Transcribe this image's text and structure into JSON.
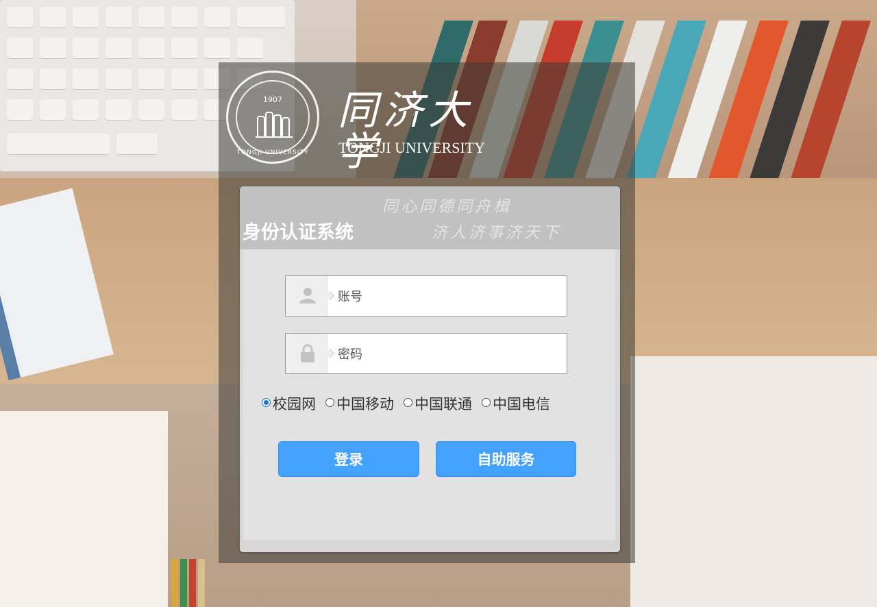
{
  "logo": {
    "seal_year": "1907",
    "seal_text": "TONGJI UNIVERSITY",
    "name_cn": "同济大学",
    "name_en": "TONGJI UNIVERSITY"
  },
  "header": {
    "title": "身份认证系统",
    "motto_line1": "同心同德同舟楫",
    "motto_line2": "济人济事济天下"
  },
  "form": {
    "account_placeholder": "账号",
    "password_placeholder": "密码",
    "network_options": [
      {
        "label": "校园网",
        "selected": true
      },
      {
        "label": "中国移动",
        "selected": false
      },
      {
        "label": "中国联通",
        "selected": false
      },
      {
        "label": "中国电信",
        "selected": false
      }
    ],
    "login_label": "登录",
    "self_service_label": "自助服务"
  },
  "icons": {
    "account": "user-icon",
    "password": "lock-icon"
  },
  "colors": {
    "button": "#44a2ff",
    "radio_selected": "#1a73e8"
  }
}
